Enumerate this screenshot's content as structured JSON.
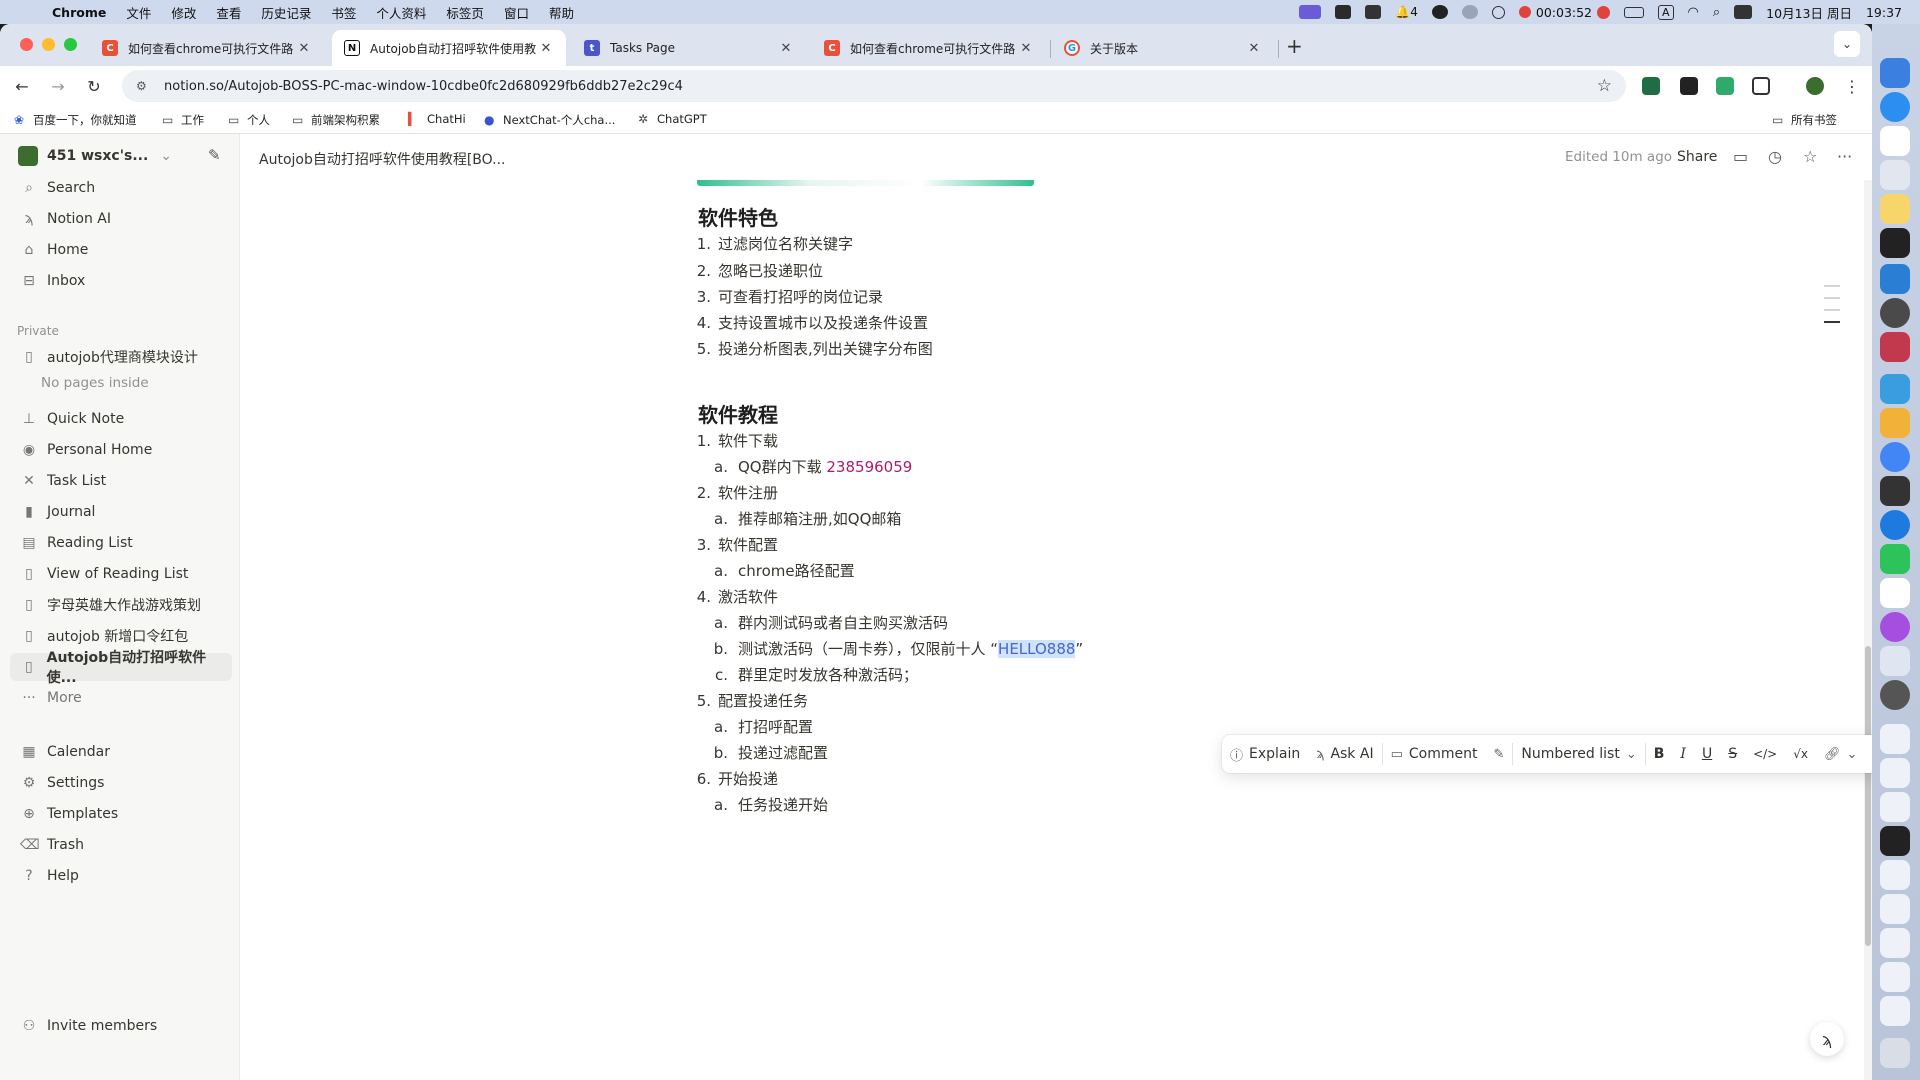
{
  "menubar": {
    "app": "Chrome",
    "items": [
      "文件",
      "修改",
      "查看",
      "历史记录",
      "书签",
      "个人资料",
      "标签页",
      "窗口",
      "帮助"
    ],
    "status": {
      "notifications": "4",
      "timer": "00:03:52",
      "input_method": "A",
      "date": "10月13日 周日",
      "time": "19:37"
    }
  },
  "tabs": [
    {
      "title": "如何查看chrome可执行文件路",
      "favicon_color": "#e8503a",
      "favicon_letter": "C"
    },
    {
      "title": "Autojob自动打招呼软件使用教",
      "favicon_color": "#111111",
      "favicon_letter": "N"
    },
    {
      "title": "Tasks Page",
      "favicon_color": "#4a56c9",
      "favicon_letter": "t"
    },
    {
      "title": "如何查看chrome可执行文件路",
      "favicon_color": "#e8503a",
      "favicon_letter": "C"
    },
    {
      "title": "关于版本",
      "favicon_color": "#2f8de4",
      "favicon_letter": "G"
    }
  ],
  "address": {
    "url": "notion.so/Autojob-BOSS-PC-mac-window-10cdbe0fc2d680929fb6ddb27e2c29c4"
  },
  "bookmarks": [
    {
      "label": "百度一下，你就知道",
      "icon": "paw-icon"
    },
    {
      "label": "工作",
      "icon": "folder-icon"
    },
    {
      "label": "个人",
      "icon": "folder-icon"
    },
    {
      "label": "前端架构积累",
      "icon": "folder-icon"
    },
    {
      "label": "ChatHi",
      "icon": "chat-icon"
    },
    {
      "label": "NextChat-个人cha...",
      "icon": "nextchat-icon"
    },
    {
      "label": "ChatGPT",
      "icon": "openai-icon"
    },
    {
      "label": "所有书签",
      "icon": "folder-icon"
    }
  ],
  "sidebar": {
    "workspace": "451 wsxc's...",
    "top": [
      {
        "label": "Search",
        "icon": "search-icon"
      },
      {
        "label": "Notion AI",
        "icon": "notion-ai-icon"
      },
      {
        "label": "Home",
        "icon": "home-icon"
      },
      {
        "label": "Inbox",
        "icon": "inbox-icon"
      }
    ],
    "private_label": "Private",
    "pages": [
      {
        "label": "autojob代理商模块设计",
        "icon": "page-icon"
      },
      {
        "label": "Quick Note",
        "icon": "pin-icon"
      },
      {
        "label": "Personal Home",
        "icon": "person-icon"
      },
      {
        "label": "Task List",
        "icon": "tasks-icon"
      },
      {
        "label": "Journal",
        "icon": "book-icon"
      },
      {
        "label": "Reading List",
        "icon": "list-icon"
      },
      {
        "label": "View of Reading List",
        "icon": "page-icon"
      },
      {
        "label": "字母英雄大作战游戏策划",
        "icon": "page-icon"
      },
      {
        "label": "autojob 新增口令红包",
        "icon": "page-icon"
      },
      {
        "label": "Autojob自动打招呼软件使...",
        "icon": "page-icon"
      }
    ],
    "no_pages": "No pages inside",
    "more": "More",
    "bottom": [
      {
        "label": "Calendar",
        "icon": "calendar-icon"
      },
      {
        "label": "Settings",
        "icon": "settings-icon"
      },
      {
        "label": "Templates",
        "icon": "templates-icon"
      },
      {
        "label": "Trash",
        "icon": "trash-icon"
      },
      {
        "label": "Help",
        "icon": "help-icon"
      }
    ],
    "invite": "Invite members"
  },
  "topbar": {
    "breadcrumb": "Autojob自动打招呼软件使用教程[BO...",
    "edited": "Edited 10m ago",
    "share": "Share"
  },
  "doc": {
    "features_heading": "软件特色",
    "features": [
      {
        "n": "1.",
        "text": "过滤岗位名称关键字"
      },
      {
        "n": "2.",
        "text": "忽略已投递职位"
      },
      {
        "n": "3.",
        "text": "可查看打招呼的岗位记录"
      },
      {
        "n": "4.",
        "text": "支持设置城市以及投递条件设置"
      },
      {
        "n": "5.",
        "text": "投递分析图表,列出关键字分布图"
      }
    ],
    "tutorial_heading": "软件教程",
    "steps": [
      {
        "n": "1.",
        "text": "软件下载",
        "subs": [
          {
            "l": "a.",
            "text": "QQ群内下载 ",
            "pink": "238596059"
          }
        ]
      },
      {
        "n": "2.",
        "text": "软件注册",
        "subs": [
          {
            "l": "a.",
            "text": "推荐邮箱注册,如QQ邮箱"
          }
        ]
      },
      {
        "n": "3.",
        "text": "软件配置",
        "subs": [
          {
            "l": "a.",
            "text": "chrome路径配置"
          }
        ]
      },
      {
        "n": "4.",
        "text": "激活软件",
        "subs": [
          {
            "l": "a.",
            "text": "群内测试码或者自主购买激活码"
          },
          {
            "l": "b.",
            "text": "测试激活码（一周卡券），仅限前十人 “",
            "highlight": "HELLO888",
            "after": "”"
          },
          {
            "l": "c.",
            "text": "群里定时发放各种激活码；"
          }
        ]
      },
      {
        "n": "5.",
        "text": "配置投递任务",
        "subs": [
          {
            "l": "a.",
            "text": "打招呼配置"
          },
          {
            "l": "b.",
            "text": "投递过滤配置"
          }
        ]
      },
      {
        "n": "6.",
        "text": "开始投递",
        "subs": [
          {
            "l": "a.",
            "text": "任务投递开始"
          }
        ]
      }
    ]
  },
  "format_toolbar": {
    "explain": "Explain",
    "ask_ai": "Ask AI",
    "comment": "Comment",
    "block_type": "Numbered list",
    "bold": "B",
    "italic": "I",
    "underline": "U",
    "strike": "S",
    "code": "</>",
    "math": "√x",
    "text_color": "#ad1a72",
    "more": "···"
  }
}
